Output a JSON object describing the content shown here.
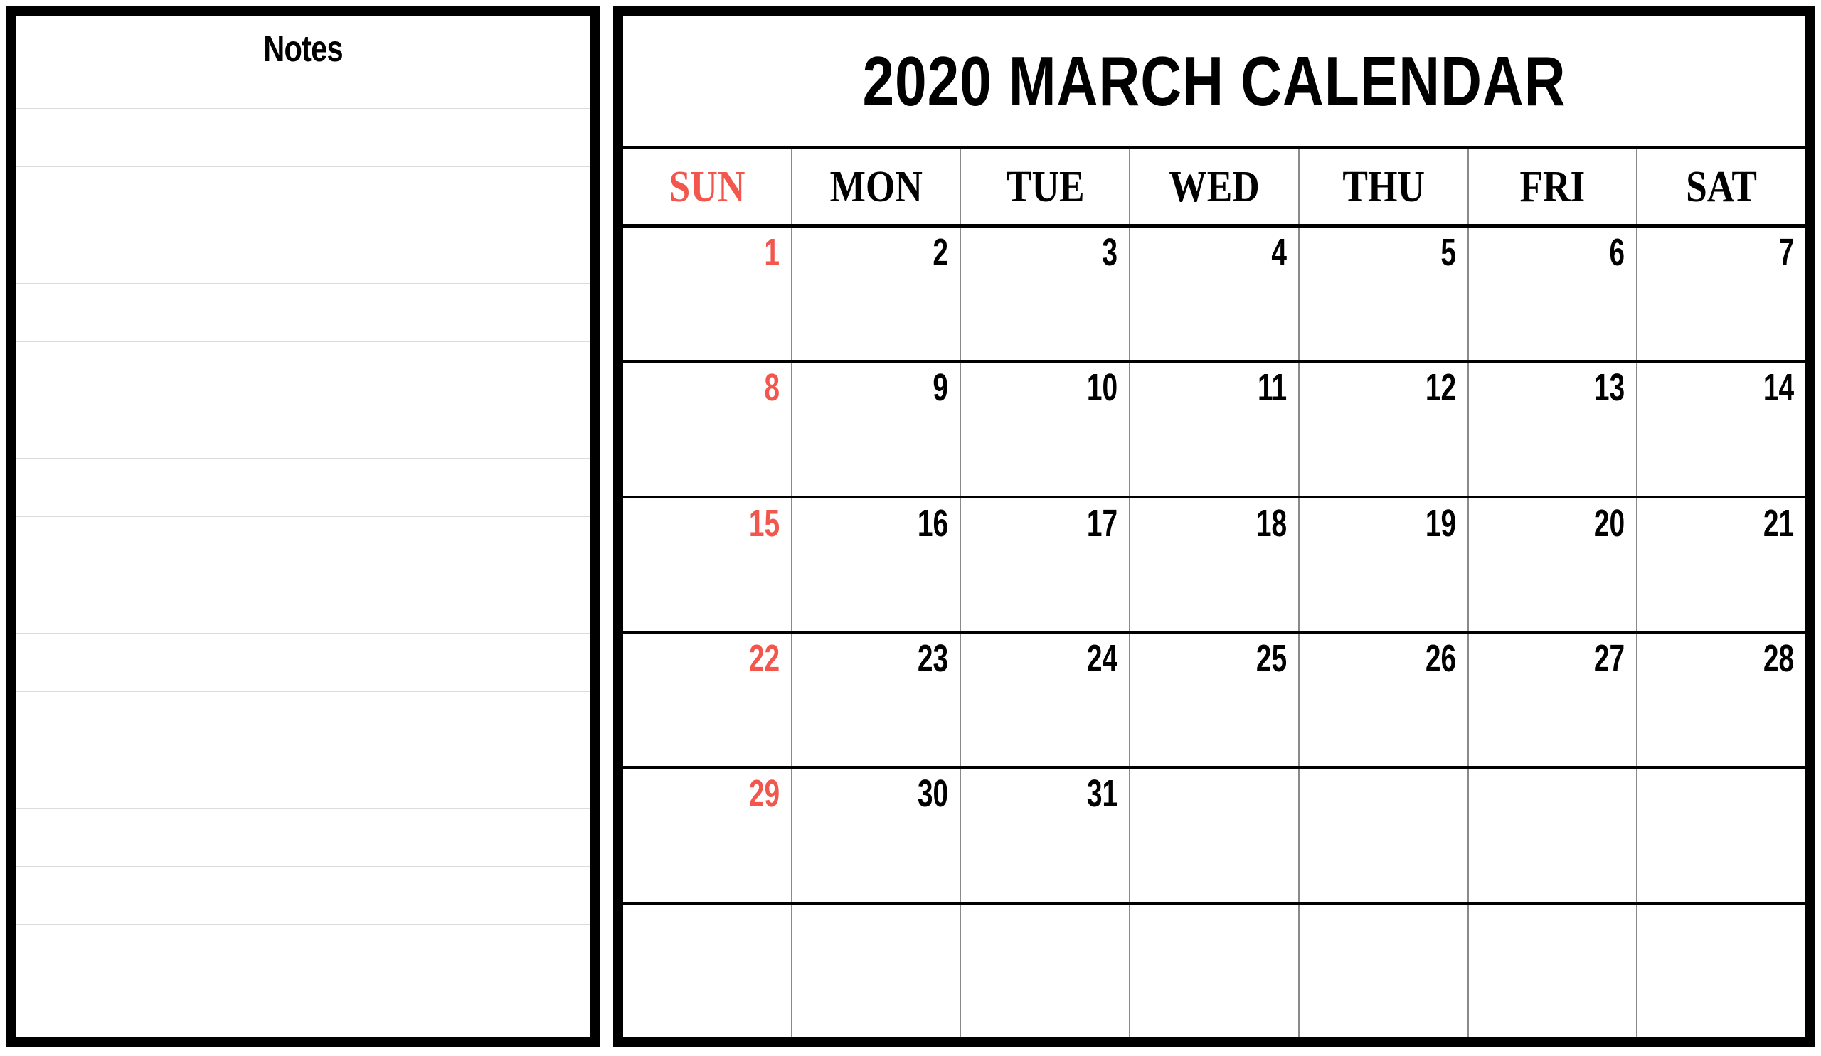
{
  "notes": {
    "title": "Notes",
    "line_count": 16,
    "line_color": "#dcdcdc"
  },
  "calendar": {
    "title": "2020 MARCH CALENDAR",
    "year": 2020,
    "month": "MARCH",
    "accent_color": "#F2564C",
    "text_color": "#000000",
    "weekdays": [
      {
        "label": "SUN",
        "highlight": true
      },
      {
        "label": "MON",
        "highlight": false
      },
      {
        "label": "TUE",
        "highlight": false
      },
      {
        "label": "WED",
        "highlight": false
      },
      {
        "label": "THU",
        "highlight": false
      },
      {
        "label": "FRI",
        "highlight": false
      },
      {
        "label": "SAT",
        "highlight": false
      }
    ],
    "weeks": [
      [
        "1",
        "2",
        "3",
        "4",
        "5",
        "6",
        "7"
      ],
      [
        "8",
        "9",
        "10",
        "11",
        "12",
        "13",
        "14"
      ],
      [
        "15",
        "16",
        "17",
        "18",
        "19",
        "20",
        "21"
      ],
      [
        "22",
        "23",
        "24",
        "25",
        "26",
        "27",
        "28"
      ],
      [
        "29",
        "30",
        "31",
        "",
        "",
        "",
        ""
      ],
      [
        "",
        "",
        "",
        "",
        "",
        "",
        ""
      ]
    ]
  }
}
